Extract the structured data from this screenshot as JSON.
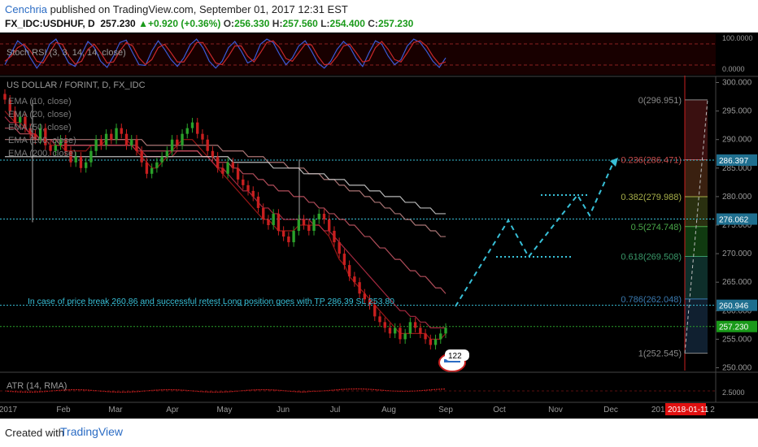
{
  "header": {
    "author": "Cenchria",
    "published_text": "published on TradingView.com, September 01, 2017 12:31 EST",
    "symbol": "FX_IDC:USDHUF, D",
    "last": "257.230",
    "change_arrow": "▲",
    "change": "+0.920 (+0.36%)",
    "o_label": "O:",
    "o": "256.330",
    "h_label": "H:",
    "h": "257.560",
    "l_label": "L:",
    "l": "254.400",
    "c_label": "C:",
    "c": "257.230"
  },
  "stoch": {
    "label": "Stoch RSI (3, 3, 14, 14, close)",
    "top_value": "100.0000",
    "bottom_value": "0.0000",
    "upper_band": 80,
    "lower_band": 20,
    "k_line": [
      20,
      55,
      90,
      75,
      40,
      10,
      35,
      80,
      95,
      60,
      25,
      15,
      50,
      88,
      70,
      30,
      12,
      45,
      85,
      92,
      55,
      20,
      18,
      60,
      90,
      65,
      35,
      15,
      40,
      78,
      95,
      70,
      30,
      10,
      30,
      70,
      88,
      60,
      25,
      35,
      80,
      95,
      85,
      50,
      20,
      40,
      75,
      90,
      60,
      25,
      10,
      30,
      65,
      88,
      72,
      38,
      15,
      55,
      90,
      80,
      45,
      20,
      35,
      75,
      95,
      85,
      60,
      30,
      12,
      40
    ],
    "d_line": [
      30,
      45,
      70,
      80,
      60,
      30,
      25,
      55,
      85,
      80,
      45,
      22,
      30,
      65,
      80,
      55,
      25,
      28,
      60,
      85,
      75,
      40,
      20,
      35,
      70,
      80,
      55,
      28,
      28,
      55,
      85,
      85,
      55,
      25,
      20,
      45,
      75,
      75,
      45,
      28,
      55,
      85,
      90,
      70,
      38,
      30,
      55,
      80,
      78,
      45,
      20,
      22,
      45,
      75,
      80,
      55,
      28,
      32,
      70,
      88,
      65,
      35,
      28,
      55,
      85,
      90,
      75,
      45,
      22,
      28
    ]
  },
  "main": {
    "title": "US DOLLAR / FORINT, D, FX_IDC",
    "legend": [
      "EMA (10, close)",
      "EMA (20, close)",
      "EMA (50, close)",
      "EMA (100, close)",
      "EMA (200, close)"
    ],
    "annotation": "In case of price break 260.86 and successful retest Long position goes with TP 286.39 SL 253.80",
    "marker_value": "122"
  },
  "chart_data": {
    "type": "candlestick",
    "title": "US DOLLAR / FORINT, D, FX_IDC",
    "x_tick_labels": [
      "2017",
      "Feb",
      "Mar",
      "Apr",
      "May",
      "Jun",
      "Jul",
      "Aug",
      "Sep",
      "Oct",
      "Nov",
      "Dec",
      "2018",
      "2"
    ],
    "y_axis_ticks": [
      300,
      295,
      290,
      285,
      280,
      275,
      270,
      265,
      260,
      255,
      250
    ],
    "y_range": [
      249.5,
      300.5
    ],
    "price_labels": [
      {
        "value": "286.397",
        "color": "#1f6f8f"
      },
      {
        "value": "276.062",
        "color": "#1f6f8f"
      },
      {
        "value": "260.946",
        "color": "#1f6f8f"
      },
      {
        "value": "257.230",
        "color": "#1a9a1a"
      }
    ],
    "horizontal_lines": [
      286.397,
      276.062,
      260.946,
      257.23
    ],
    "fibonacci": [
      {
        "level": "0",
        "value": 296.951,
        "label": "0(296.951)",
        "color": "#8a8a8a"
      },
      {
        "level": "0.236",
        "value": 286.471,
        "label": "0.236(286.471)",
        "color": "#c84a4a"
      },
      {
        "level": "0.382",
        "value": 279.988,
        "label": "0.382(279.988)",
        "color": "#a8b04a"
      },
      {
        "level": "0.5",
        "value": 274.748,
        "label": "0.5(274.748)",
        "color": "#4aa84a"
      },
      {
        "level": "0.618",
        "value": 269.508,
        "label": "0.618(269.508)",
        "color": "#3a9a6a"
      },
      {
        "level": "0.786",
        "value": 262.048,
        "label": "0.786(262.048)",
        "color": "#3a7ab0"
      },
      {
        "level": "1",
        "value": 252.545,
        "label": "1(252.545)",
        "color": "#8a8a8a"
      }
    ],
    "candle_closes": [
      297,
      295,
      293,
      294,
      292,
      291,
      290,
      292,
      289,
      288,
      289,
      290,
      288,
      286,
      287,
      285,
      286,
      288,
      290,
      289,
      291,
      290,
      292,
      291,
      289,
      290,
      288,
      286,
      284,
      285,
      286,
      287,
      288,
      290,
      289,
      291,
      292,
      293,
      291,
      290,
      288,
      287,
      285,
      284,
      286,
      285,
      283,
      282,
      281,
      280,
      278,
      276,
      275,
      277,
      274,
      273,
      272,
      274,
      276,
      275,
      274,
      276,
      277,
      276,
      274,
      272,
      270,
      268,
      266,
      265,
      263,
      262,
      261,
      259,
      258,
      257,
      256,
      257,
      255,
      256,
      258,
      257,
      256,
      255,
      254,
      255,
      256,
      257
    ],
    "ema": [
      {
        "name": "EMA (10, close)",
        "color": "#b01a1a",
        "values": [
          295,
          294,
          293,
          293,
          292,
          291,
          291,
          290,
          290,
          289,
          289,
          289,
          288,
          288,
          288,
          288,
          288,
          289,
          289,
          289,
          290,
          290,
          290,
          290,
          290,
          289,
          288,
          287,
          286,
          285,
          285,
          286,
          287,
          288,
          289,
          290,
          290,
          290,
          289,
          288,
          287,
          286,
          285,
          284,
          283,
          282,
          281,
          280,
          279,
          278,
          277,
          276,
          276,
          275,
          274,
          274,
          274,
          274,
          275,
          275,
          275,
          275,
          275,
          274,
          273,
          271,
          269,
          268,
          266,
          265,
          264,
          263,
          262,
          261,
          260,
          259,
          258,
          257,
          256,
          256,
          256,
          256,
          256,
          256,
          255,
          255,
          255,
          256
        ]
      },
      {
        "name": "EMA (20, close)",
        "color": "#c0304a",
        "values": [
          294,
          293,
          293,
          292,
          292,
          291,
          291,
          290,
          290,
          290,
          289,
          289,
          289,
          289,
          289,
          289,
          289,
          289,
          289,
          289,
          289,
          289,
          289,
          289,
          289,
          289,
          288,
          288,
          287,
          287,
          287,
          287,
          287,
          287,
          288,
          288,
          288,
          288,
          288,
          287,
          287,
          286,
          285,
          285,
          284,
          283,
          282,
          281,
          281,
          280,
          279,
          278,
          278,
          277,
          277,
          276,
          276,
          276,
          276,
          276,
          276,
          275,
          275,
          274,
          274,
          273,
          272,
          271,
          270,
          269,
          268,
          267,
          266,
          265,
          264,
          263,
          262,
          261,
          260,
          260,
          259,
          259,
          258,
          258,
          257,
          257,
          257,
          257
        ]
      },
      {
        "name": "EMA (50, close)",
        "color": "#d05a6a",
        "values": [
          292,
          292,
          292,
          291,
          291,
          291,
          290,
          290,
          290,
          290,
          290,
          289,
          289,
          289,
          289,
          289,
          289,
          289,
          289,
          289,
          289,
          289,
          289,
          289,
          289,
          289,
          289,
          288,
          288,
          288,
          288,
          288,
          288,
          288,
          288,
          288,
          288,
          288,
          288,
          287,
          287,
          287,
          286,
          286,
          286,
          285,
          285,
          284,
          284,
          284,
          283,
          283,
          282,
          282,
          281,
          281,
          281,
          280,
          280,
          280,
          279,
          279,
          278,
          278,
          277,
          277,
          276,
          276,
          275,
          275,
          274,
          273,
          273,
          272,
          271,
          271,
          270,
          269,
          269,
          268,
          267,
          267,
          266,
          266,
          265,
          264,
          264,
          263
        ]
      },
      {
        "name": "EMA (100, close)",
        "color": "#c88a8a",
        "values": [
          290,
          290,
          290,
          290,
          290,
          290,
          290,
          290,
          290,
          290,
          290,
          290,
          290,
          290,
          290,
          290,
          290,
          290,
          290,
          290,
          290,
          290,
          290,
          290,
          290,
          290,
          290,
          290,
          289,
          289,
          289,
          289,
          289,
          289,
          289,
          289,
          289,
          289,
          289,
          289,
          289,
          289,
          289,
          288,
          288,
          288,
          288,
          288,
          287,
          287,
          287,
          287,
          286,
          286,
          286,
          286,
          285,
          285,
          285,
          285,
          284,
          284,
          284,
          283,
          283,
          283,
          282,
          282,
          281,
          281,
          281,
          280,
          280,
          279,
          279,
          278,
          278,
          277,
          277,
          276,
          276,
          275,
          275,
          275,
          274,
          274,
          273,
          273
        ]
      },
      {
        "name": "EMA (200, close)",
        "color": "#d8d8d8",
        "values": [
          287,
          287,
          287,
          287,
          287,
          287,
          287,
          287,
          287,
          287,
          287,
          287,
          287,
          287,
          287,
          287,
          287,
          287,
          287,
          287,
          287,
          287,
          287,
          287,
          287,
          287,
          287,
          287,
          287,
          287,
          287,
          287,
          287,
          287,
          287,
          287,
          287,
          287,
          287,
          287,
          287,
          287,
          287,
          287,
          287,
          286,
          286,
          286,
          286,
          286,
          286,
          286,
          286,
          285,
          285,
          285,
          285,
          285,
          285,
          284,
          284,
          284,
          284,
          284,
          283,
          283,
          283,
          283,
          282,
          282,
          282,
          282,
          281,
          281,
          281,
          280,
          280,
          280,
          280,
          279,
          279,
          279,
          278,
          278,
          278,
          277,
          277,
          277
        ]
      }
    ]
  },
  "atr": {
    "label": "ATR (14, RMA)",
    "value_label": "2.5000"
  },
  "time_axis": {
    "highlight_label": "2018-01-11"
  },
  "footer": {
    "created_with": "Created with",
    "brand": "TradingView"
  },
  "colors": {
    "bull": "#2aa12a",
    "bear": "#c81f1f",
    "projection": "#38c0d8",
    "grid_line": "#38c0d8",
    "current_price": "#2aa12a"
  }
}
